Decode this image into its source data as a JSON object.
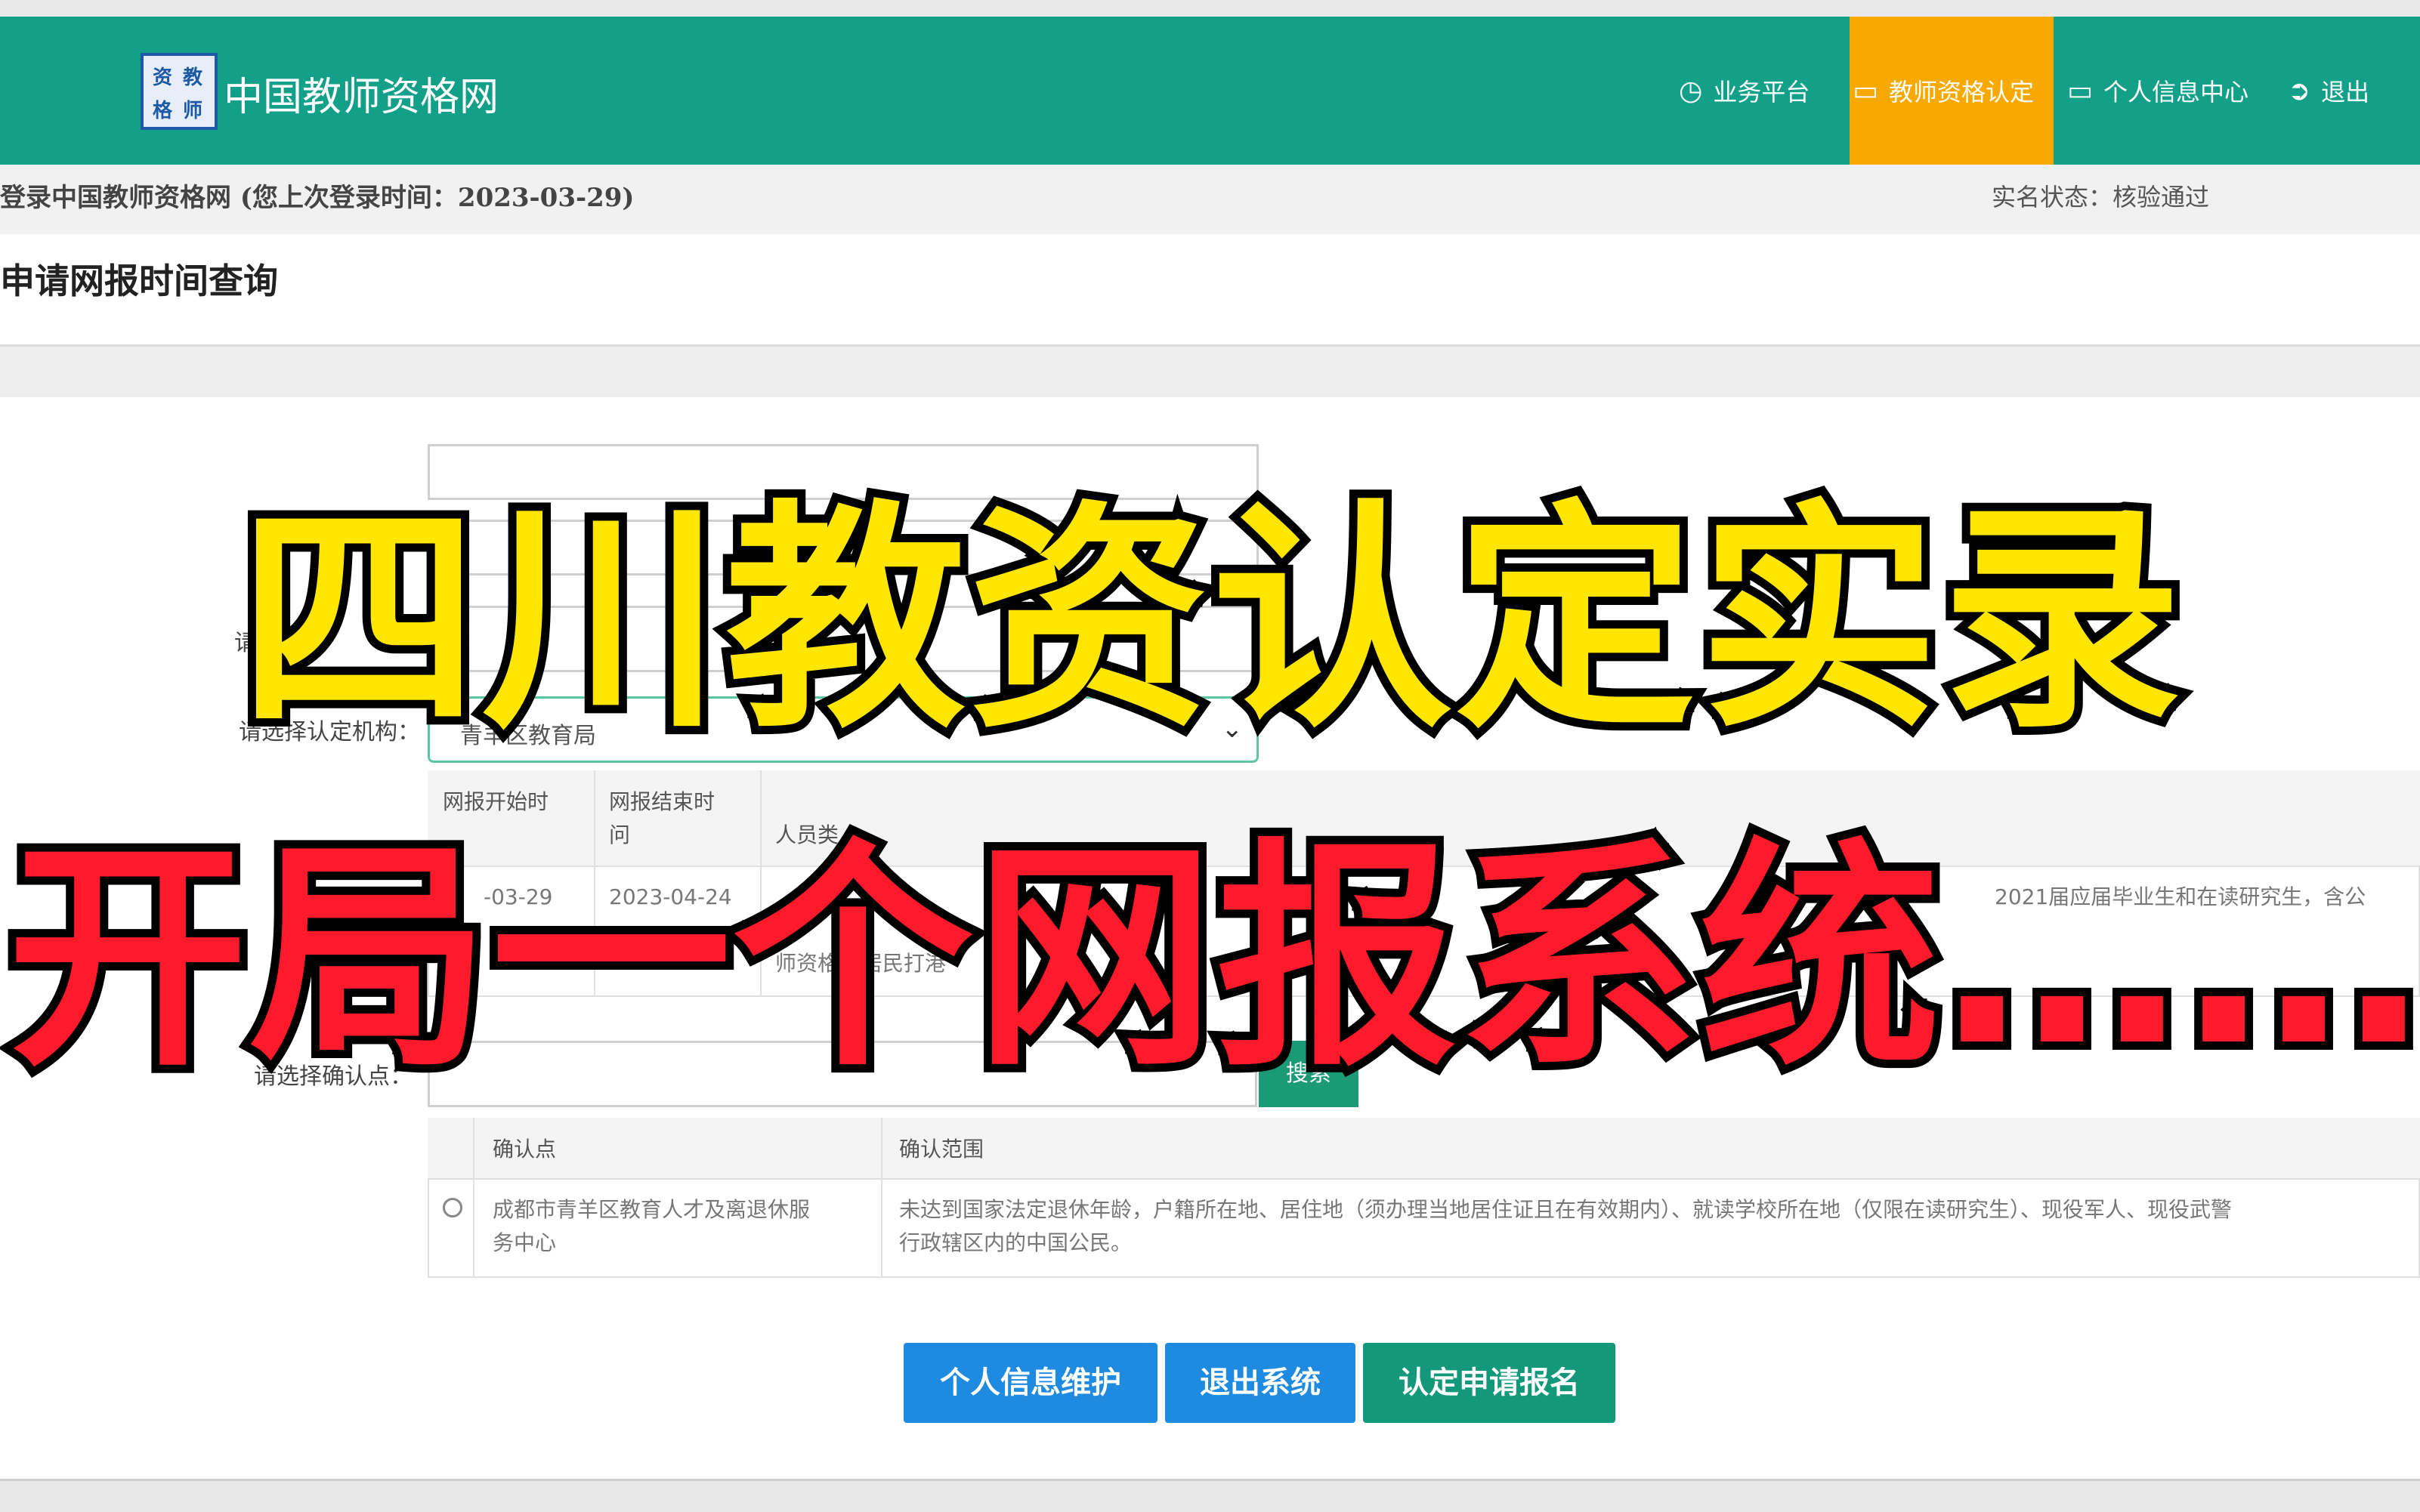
{
  "header": {
    "logo_chars": [
      "资",
      "教",
      "格",
      "师"
    ],
    "site_title": "中国教师资格网",
    "nav": [
      {
        "icon": "dashboard-icon",
        "label": "业务平台",
        "active": false
      },
      {
        "icon": "monitor-icon",
        "label": "教师资格认定",
        "active": true
      },
      {
        "icon": "monitor-icon",
        "label": "个人信息中心",
        "active": false
      },
      {
        "icon": "logout-icon",
        "label": "退出",
        "active": false
      }
    ],
    "active_color": "#f7a900",
    "brand_color": "#12a089"
  },
  "infobar": {
    "login_text": "登录中国教师资格网 (您上次登录时间：2023-03-29)",
    "realname_status": "实名状态：核验通过"
  },
  "page_title": "申请网报时间查询",
  "form": {
    "field3_label": "请",
    "institution_label": "请选择认定机构：",
    "institution_value": "青羊区教育局",
    "confirm_point_label": "请选择确认点：",
    "search_label": "搜索"
  },
  "schedule_table": {
    "headers": [
      "网报开始时",
      "网报结束时",
      "问",
      "人员类"
    ],
    "row": {
      "start": "-03-29",
      "end": "2023-04-24",
      "note_fragment_1": "师资格",
      "note_fragment_2": "居民打港",
      "note_fragment_3": "2021届应届毕业生和在读研究生，含公"
    }
  },
  "confirm_table": {
    "headers": [
      "确认点",
      "确认范围"
    ],
    "row": {
      "point_line1": "成都市青羊区教育人才及离退休服",
      "point_line2": "务中心",
      "scope_line1": "未达到国家法定退休年龄，户籍所在地、居住地（须办理当地居住证且在有效期内）、就读学校所在地（仅限在读研究生）、现役军人、现役武警",
      "scope_line2": "行政辖区内的中国公民。"
    }
  },
  "buttons": {
    "profile": "个人信息维护",
    "exit": "退出系统",
    "apply": "认定申请报名"
  },
  "overlay": {
    "line1": "四川教资认定实录",
    "line2": "开局一个网报系统……",
    "line1_color": "#ffe600",
    "line2_color": "#ff1a2b"
  }
}
